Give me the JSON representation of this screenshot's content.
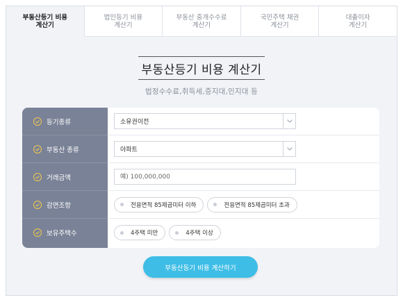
{
  "tabs": [
    {
      "label": "부동산등기 비용\n계산기"
    },
    {
      "label": "법인등기 비용\n계산기"
    },
    {
      "label": "부동산 중개수수료\n계산기"
    },
    {
      "label": "국민주택 채권\n계산기"
    },
    {
      "label": "대출이자\n계산기"
    }
  ],
  "active_tab": 0,
  "heading": {
    "title": "부동산등기 비용 계산기",
    "subtitle": "법정수수료,취득세,증지대,인지대 등"
  },
  "form": {
    "registration_type": {
      "label": "등기종류",
      "value": "소유권이전"
    },
    "property_type": {
      "label": "부동산 종류",
      "value": "아파트"
    },
    "price": {
      "label": "거래금액",
      "placeholder": "예) 100,000,000"
    },
    "reduction": {
      "label": "감면조항",
      "options": [
        "전용면적 85제곱미터 이하",
        "전용면적 85제곱미터 초과"
      ]
    },
    "houses_owned": {
      "label": "보유주택수",
      "options": [
        "4주택 미만",
        "4주택 이상"
      ]
    }
  },
  "submit_label": "부동산등기 비용 계산하기",
  "colors": {
    "label_bg": "#7a8297",
    "check_accent": "#f2c94c",
    "button_bg": "#3ebde6",
    "panel_bg": "#f1f3f7"
  }
}
